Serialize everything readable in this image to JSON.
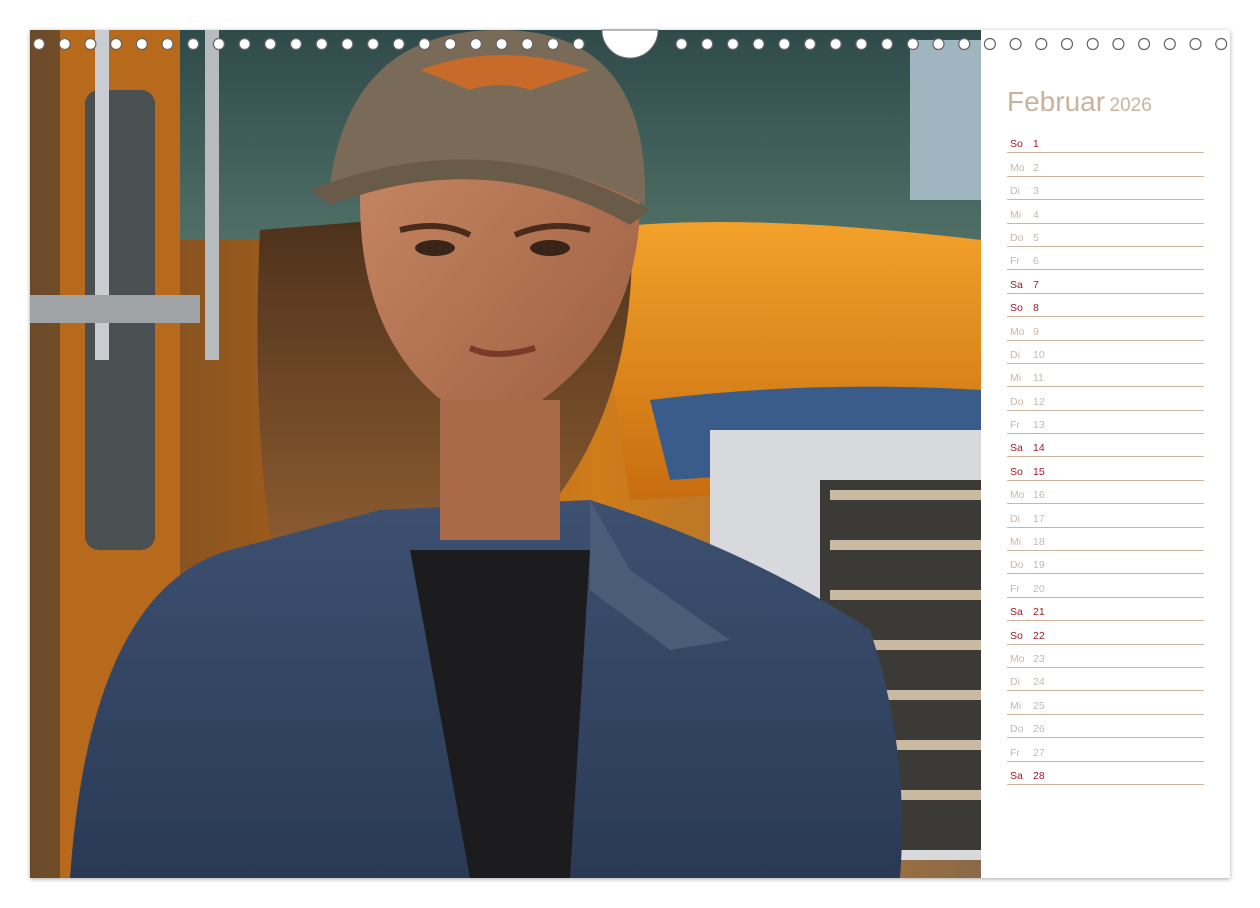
{
  "calendar": {
    "month": "Februar",
    "year": "2026",
    "days": [
      {
        "dn": "So",
        "d": "1",
        "we": true
      },
      {
        "dn": "Mo",
        "d": "2",
        "we": false
      },
      {
        "dn": "Di",
        "d": "3",
        "we": false
      },
      {
        "dn": "Mi",
        "d": "4",
        "we": false
      },
      {
        "dn": "Do",
        "d": "5",
        "we": false
      },
      {
        "dn": "Fr",
        "d": "6",
        "we": false
      },
      {
        "dn": "Sa",
        "d": "7",
        "we": true
      },
      {
        "dn": "So",
        "d": "8",
        "we": true
      },
      {
        "dn": "Mo",
        "d": "9",
        "we": false
      },
      {
        "dn": "Di",
        "d": "10",
        "we": false
      },
      {
        "dn": "Mi",
        "d": "11",
        "we": false
      },
      {
        "dn": "Do",
        "d": "12",
        "we": false
      },
      {
        "dn": "Fr",
        "d": "13",
        "we": false
      },
      {
        "dn": "Sa",
        "d": "14",
        "we": true
      },
      {
        "dn": "So",
        "d": "15",
        "we": true
      },
      {
        "dn": "Mo",
        "d": "16",
        "we": false
      },
      {
        "dn": "Di",
        "d": "17",
        "we": false
      },
      {
        "dn": "Mi",
        "d": "18",
        "we": false
      },
      {
        "dn": "Do",
        "d": "19",
        "we": false
      },
      {
        "dn": "Fr",
        "d": "20",
        "we": false
      },
      {
        "dn": "Sa",
        "d": "21",
        "we": true
      },
      {
        "dn": "So",
        "d": "22",
        "we": true
      },
      {
        "dn": "Mo",
        "d": "23",
        "we": false
      },
      {
        "dn": "Di",
        "d": "24",
        "we": false
      },
      {
        "dn": "Mi",
        "d": "25",
        "we": false
      },
      {
        "dn": "Do",
        "d": "26",
        "we": false
      },
      {
        "dn": "Fr",
        "d": "27",
        "we": false
      },
      {
        "dn": "Sa",
        "d": "28",
        "we": true
      }
    ]
  },
  "colors": {
    "weekend": "#a0192b",
    "weekday": "#c9b8aa",
    "title": "#c9b39f",
    "rule": "#cdb5a0",
    "truck_orange": "#e8921c"
  },
  "photo": {
    "icon": "portrait-photo"
  }
}
